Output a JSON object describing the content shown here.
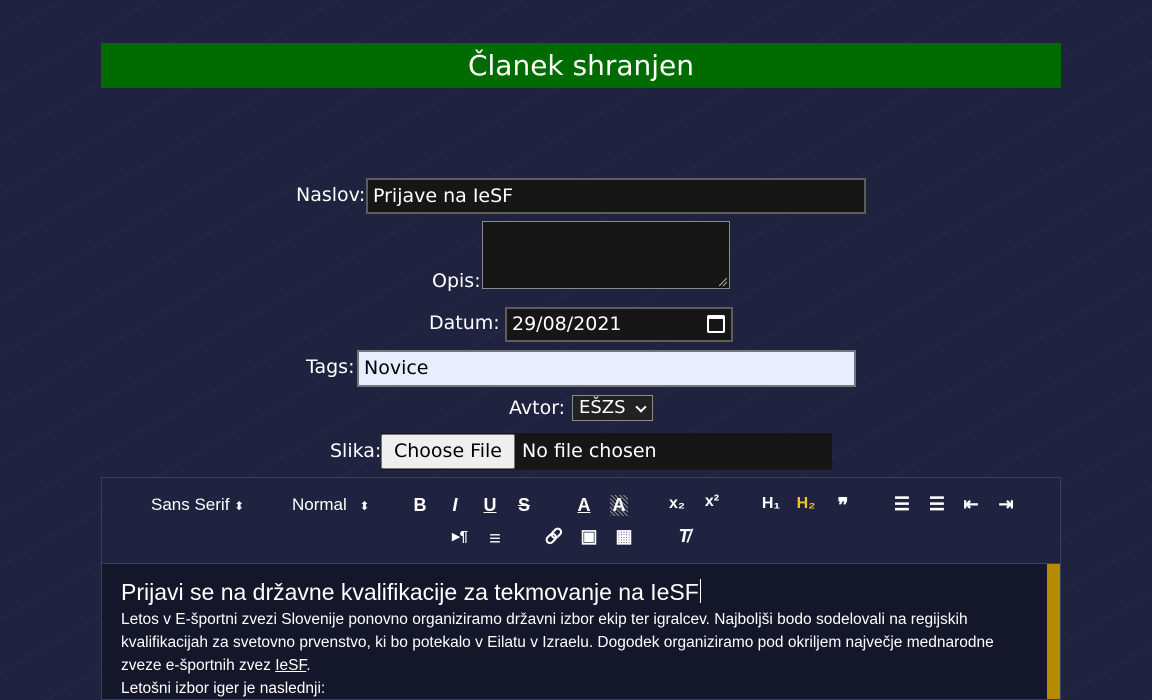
{
  "banner": {
    "text": "Članek shranjen",
    "color": "#006b00"
  },
  "form": {
    "title_label": "Naslov:",
    "title_value": "Prijave na IeSF",
    "description_label": "Opis:",
    "description_value": "",
    "date_label": "Datum:",
    "date_value": "29/08/2021",
    "tags_label": "Tags:",
    "tags_value": "Novice",
    "author_label": "Avtor:",
    "author_selected": "EŠZS",
    "image_label": "Slika:",
    "file_button": "Choose File",
    "file_status": "No file chosen"
  },
  "toolbar": {
    "font_family": "Sans Serif",
    "font_size": "Normal",
    "buttons": [
      {
        "name": "bold-icon",
        "glyph": "B"
      },
      {
        "name": "italic-icon",
        "glyph": "I"
      },
      {
        "name": "underline-icon",
        "glyph": "U"
      },
      {
        "name": "strike-icon",
        "glyph": "S"
      },
      {
        "name": "text-color-icon",
        "glyph": "A"
      },
      {
        "name": "background-color-icon",
        "glyph": "A"
      },
      {
        "name": "subscript-icon",
        "glyph": "x₂"
      },
      {
        "name": "superscript-icon",
        "glyph": "x²"
      },
      {
        "name": "heading-1-icon",
        "glyph": "H₁"
      },
      {
        "name": "heading-2-icon",
        "glyph": "H₂",
        "active": true
      },
      {
        "name": "blockquote-icon",
        "glyph": "❞"
      },
      {
        "name": "ordered-list-icon",
        "glyph": "☰"
      },
      {
        "name": "bullet-list-icon",
        "glyph": "☰"
      },
      {
        "name": "outdent-icon",
        "glyph": "⇤"
      },
      {
        "name": "indent-icon",
        "glyph": "⇥"
      },
      {
        "name": "direction-rtl-icon",
        "glyph": "▸¶"
      },
      {
        "name": "align-icon",
        "glyph": "≡"
      },
      {
        "name": "link-icon",
        "glyph": "🔗"
      },
      {
        "name": "image-icon",
        "glyph": "▣"
      },
      {
        "name": "video-icon",
        "glyph": "▦"
      },
      {
        "name": "clean-format-icon",
        "glyph": "T̸"
      }
    ],
    "active_color": "#f4c21b"
  },
  "editor": {
    "heading": "Prijavi se na državne kvalifikacije za tekmovanje na IeSF",
    "paragraph_1": "Letos v E-športni zvezi Slovenije ponovno organiziramo državni izbor ekip ter igralcev. Najboljši bodo sodelovali na regijskih kvalifikacijah za svetovno prvenstvo, ki bo potekalo v Eilatu v Izraelu. Dogodek organiziramo pod okriljem največje mednarodne zveze e-športnih zvez ",
    "paragraph_1_link": "IeSF",
    "paragraph_1_end": ".",
    "paragraph_2": "Letošni izbor iger je naslednji:",
    "scrollbar_color": "#b58a00"
  }
}
